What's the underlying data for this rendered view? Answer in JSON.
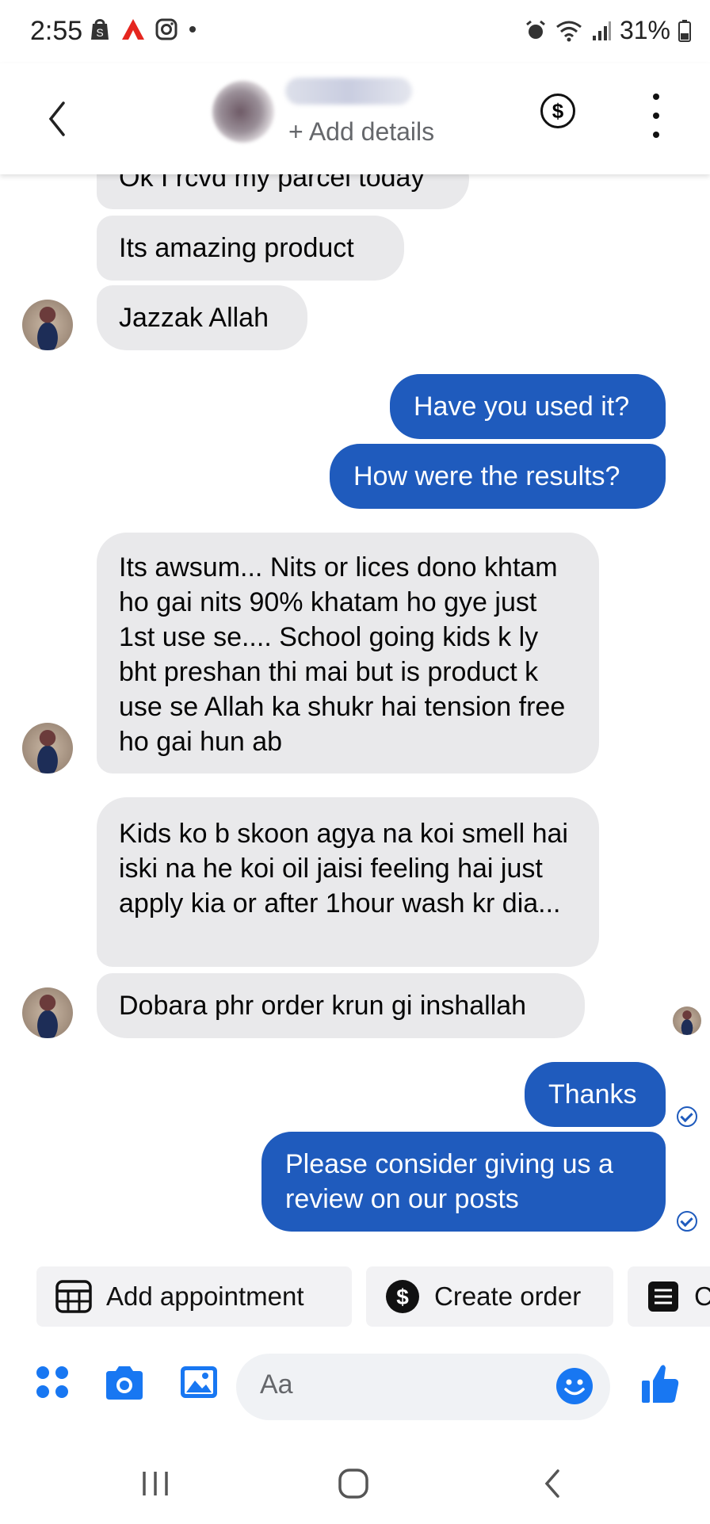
{
  "status_bar": {
    "time": "2:55",
    "battery": "31%"
  },
  "header": {
    "subtitle": "+ Add details"
  },
  "messages": [
    {
      "from": "them",
      "text": "Ok I rcvd my parcel today"
    },
    {
      "from": "them",
      "text": "Its amazing product"
    },
    {
      "from": "them",
      "text": "Jazzak Allah"
    },
    {
      "from": "me",
      "text": "Have you used it?"
    },
    {
      "from": "me",
      "text": "How were the results?"
    },
    {
      "from": "them",
      "text": "Its awsum... Nits or lices dono khtam ho gai nits 90% khatam ho gye just 1st use se.... School going kids k ly bht preshan thi mai but is product k use se Allah ka shukr hai tension free ho gai hun ab"
    },
    {
      "from": "them",
      "text": "Kids ko b skoon agya na koi smell hai iski na he koi oil jaisi feeling hai just apply kia or after 1hour wash kr dia..."
    },
    {
      "from": "them",
      "text": "Dobara phr order krun gi inshallah"
    },
    {
      "from": "me",
      "text": "Thanks"
    },
    {
      "from": "me",
      "text": "Please consider giving us a review on our posts"
    }
  ],
  "quick_replies": [
    {
      "label": "Add appointment",
      "icon": "calendar-icon"
    },
    {
      "label": "Create order",
      "icon": "dollar-icon"
    },
    {
      "label": "C",
      "icon": "receipt-icon"
    }
  ],
  "composer": {
    "placeholder": "Aa"
  },
  "colors": {
    "accent": "#1f5bbd",
    "incoming_bubble": "#e9e9eb",
    "icon_blue": "#1877f2"
  }
}
